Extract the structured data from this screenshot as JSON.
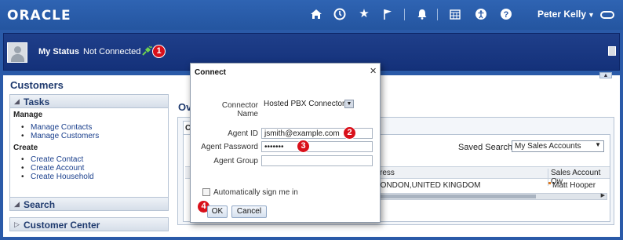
{
  "header": {
    "logo": "ORACLE",
    "user_name": "Peter Kelly",
    "icons": [
      "home-icon",
      "clock-icon",
      "star-icon",
      "flag-icon",
      "bell-icon",
      "calendar-icon",
      "accessibility-icon",
      "help-icon",
      "toggle-icon"
    ]
  },
  "status": {
    "label": "My Status",
    "value": "Not Connected",
    "badge": "1"
  },
  "main": {
    "title": "Customers",
    "tasks": {
      "label": "Tasks",
      "manage_label": "Manage",
      "manage_items": [
        "Manage Contacts",
        "Manage Customers"
      ],
      "create_label": "Create",
      "create_items": [
        "Create Contact",
        "Create Account",
        "Create Household"
      ]
    },
    "search_label": "Search",
    "customer_center_label": "Customer Center",
    "overview": {
      "title": "Ov",
      "tab": "Co",
      "saved_search_label": "Saved Search",
      "saved_search_value": "My Sales Accounts",
      "columns": [
        "ress",
        "Sales Account Ow"
      ],
      "rows": [
        {
          "address": "et,LONDON,UNITED KINGDOM",
          "owner": "Matt Hooper"
        }
      ]
    }
  },
  "dialog": {
    "title": "Connect",
    "connector_label": "Connector Name",
    "connector_value": "Hosted PBX Connector",
    "agent_id_label": "Agent ID",
    "agent_id_value": "jsmith@example.com",
    "agent_password_label": "Agent Password",
    "agent_password_value": "•••••••",
    "agent_group_label": "Agent Group",
    "agent_group_value": "",
    "auto_signin_label": "Automatically sign me in",
    "ok_label": "OK",
    "cancel_label": "Cancel",
    "badges": [
      "2",
      "3",
      "4"
    ]
  },
  "colors": {
    "header_blue": "#2a5aa8",
    "status_navy": "#1a3a85",
    "badge_red": "#d9101a",
    "link_blue": "#1a3f8c"
  }
}
